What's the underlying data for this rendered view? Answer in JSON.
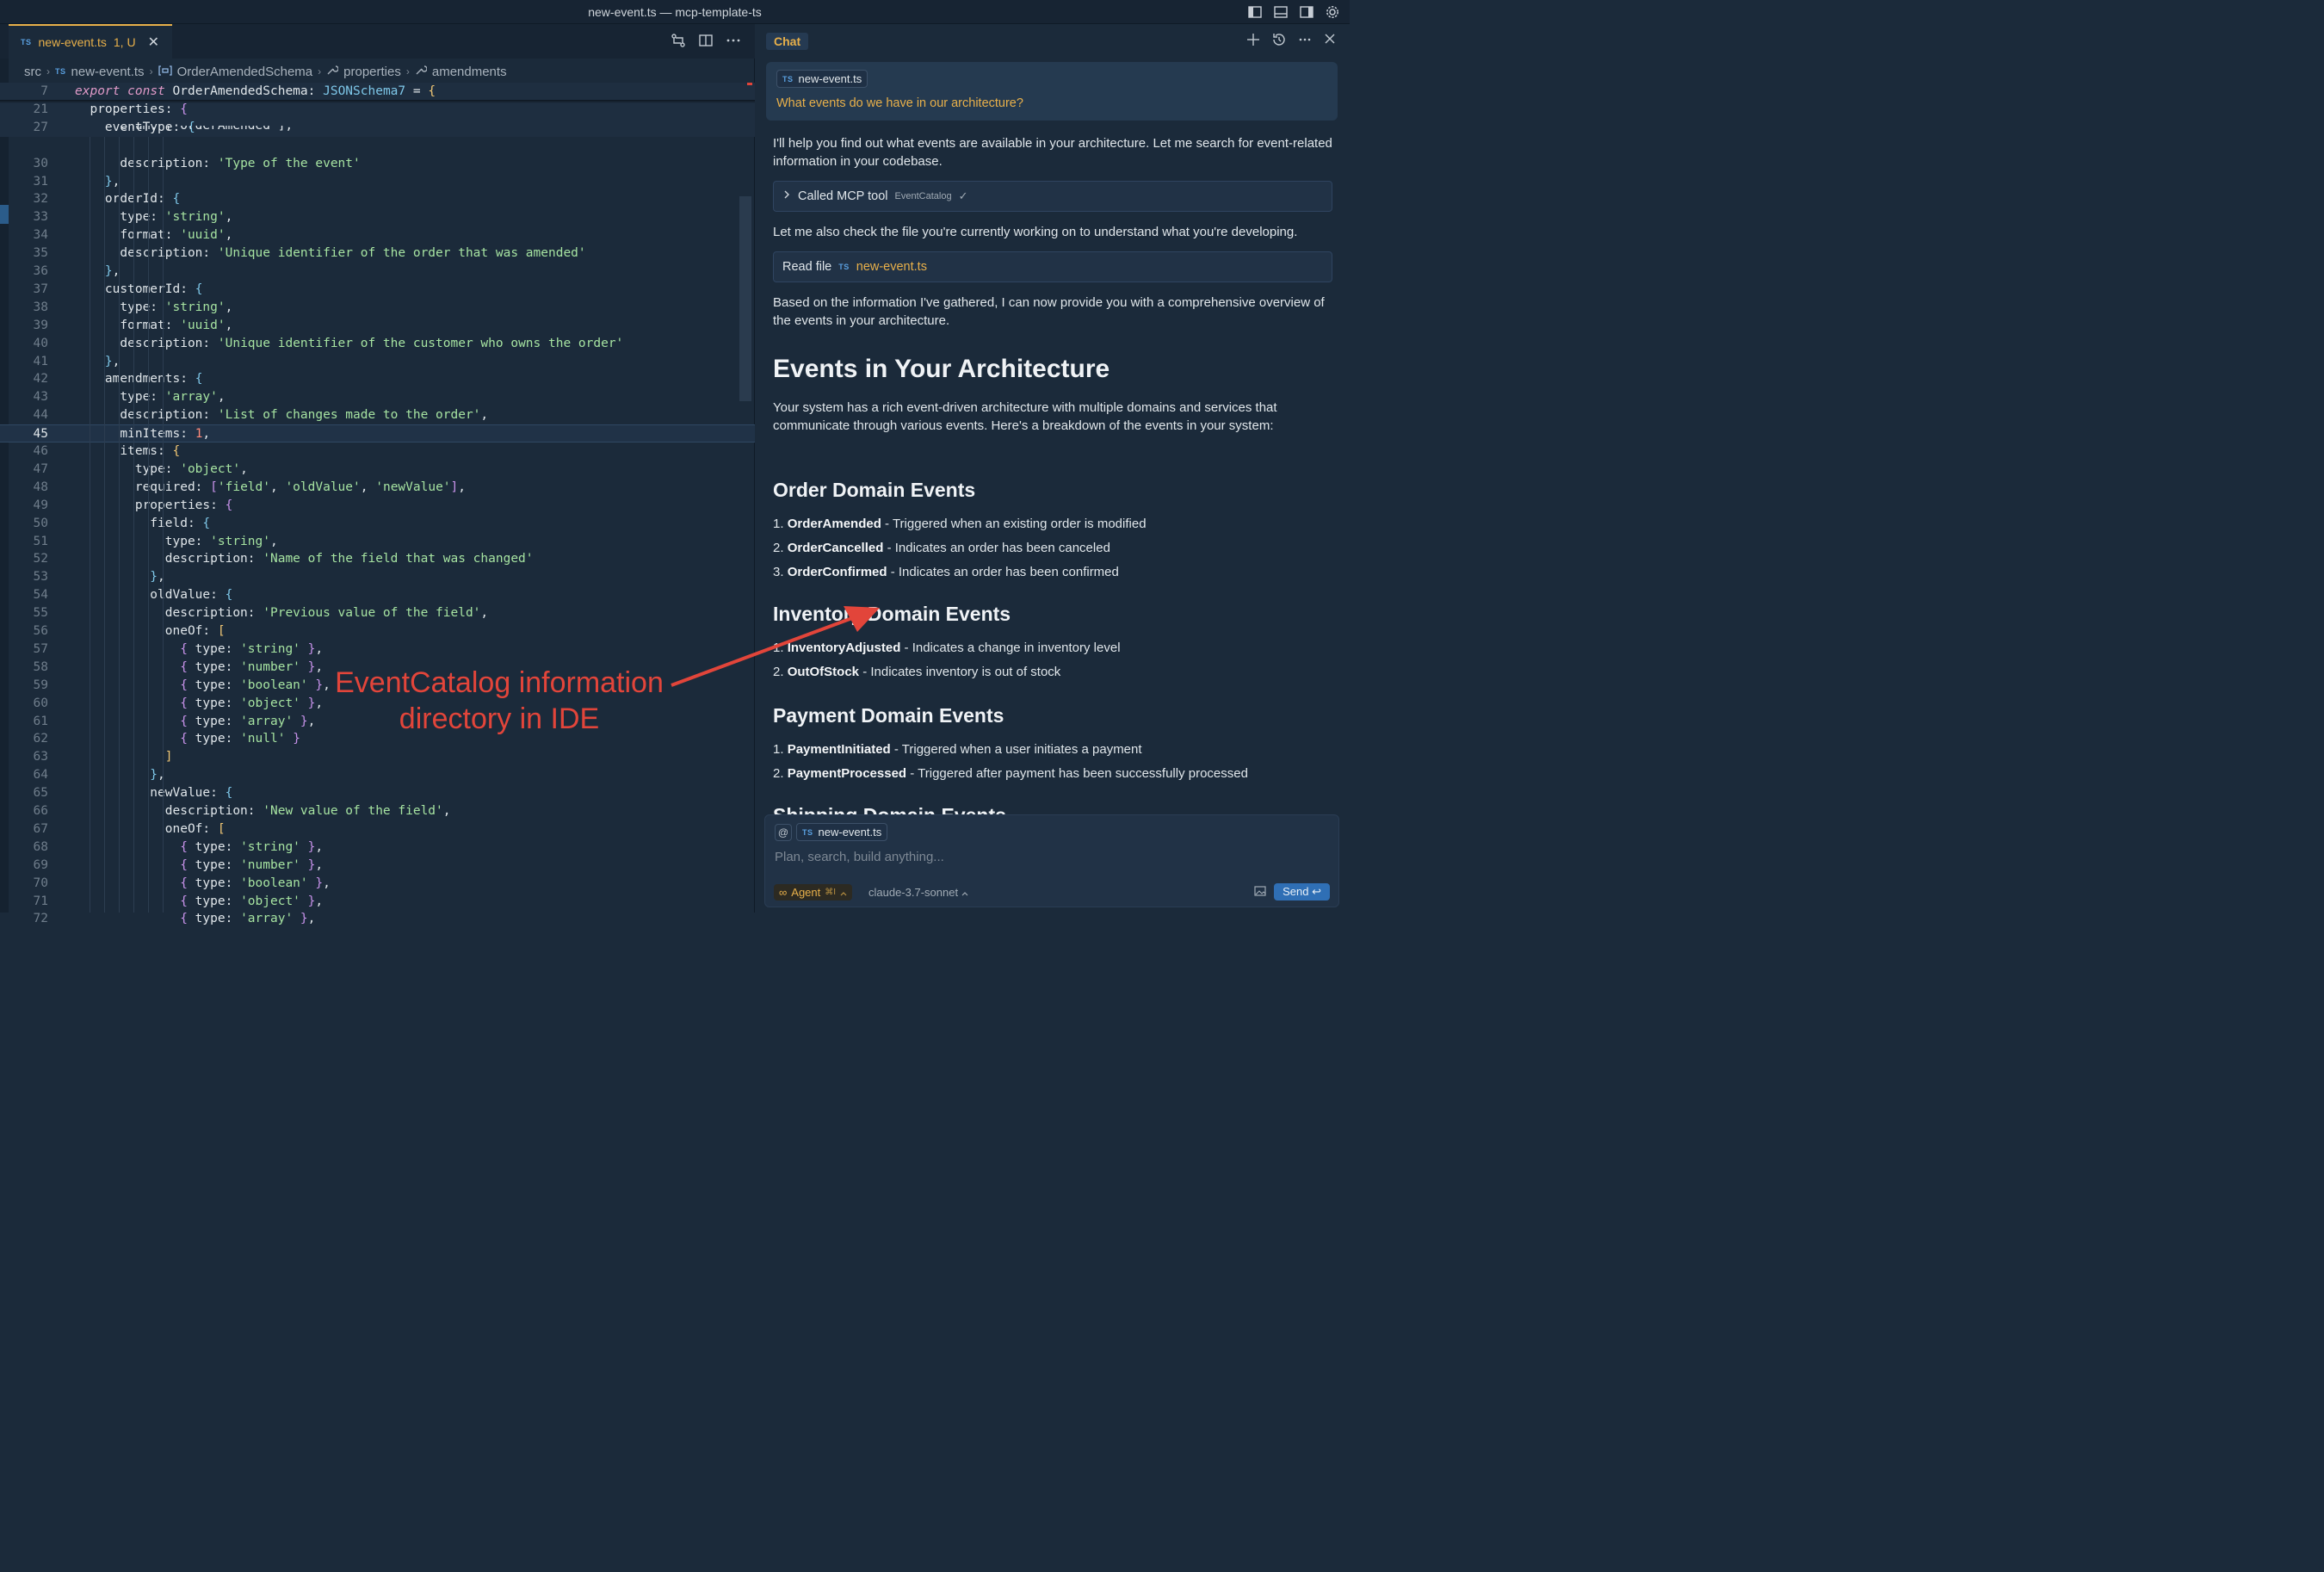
{
  "window": {
    "title": "new-event.ts — mcp-template-ts"
  },
  "editor": {
    "tab": {
      "badge": "TS",
      "label": "new-event.ts",
      "status": "1, U",
      "close": "✕"
    },
    "breadcrumb": [
      "src",
      "new-event.ts",
      "OrderAmendedSchema",
      "properties",
      "amendments"
    ],
    "breadcrumb_badge": "TS"
  },
  "annotation": {
    "line1": "EventCatalog information",
    "line2": "directory in IDE"
  },
  "chat": {
    "tab_label": "Chat",
    "user": {
      "chip": "new-event.ts",
      "chip_badge": "TS",
      "question": "What events do we have in our architecture?"
    },
    "intro": "I'll help you find out what events are available in your architecture. Let me search for event-related information in your codebase.",
    "tool_call": {
      "label": "Called MCP tool",
      "tool": "EventCatalog",
      "status": "✓"
    },
    "check_file_text": "Let me also check the file you're currently working on to understand what you're developing.",
    "read_file": {
      "label": "Read file",
      "badge": "TS",
      "file": "new-event.ts"
    },
    "summary": "Based on the information I've gathered, I can now provide you with a comprehensive overview of the events in your architecture.",
    "heading": "Events in Your Architecture",
    "overview": "Your system has a rich event-driven architecture with multiple domains and services that communicate through various events. Here's a breakdown of the events in your system:",
    "sections": [
      {
        "title": "Order Domain Events",
        "items": [
          {
            "num": "1.",
            "name": "OrderAmended",
            "desc": " - Triggered when an existing order is modified"
          },
          {
            "num": "2.",
            "name": "OrderCancelled",
            "desc": " - Indicates an order has been canceled"
          },
          {
            "num": "3.",
            "name": "OrderConfirmed",
            "desc": " - Indicates an order has been confirmed"
          }
        ]
      },
      {
        "title": "Inventory Domain Events",
        "items": [
          {
            "num": "1.",
            "name": "InventoryAdjusted",
            "desc": " - Indicates a change in inventory level"
          },
          {
            "num": "2.",
            "name": "OutOfStock",
            "desc": " - Indicates inventory is out of stock"
          }
        ]
      },
      {
        "title": "Payment Domain Events",
        "items": [
          {
            "num": "1.",
            "name": "PaymentInitiated",
            "desc": " - Triggered when a user initiates a payment"
          },
          {
            "num": "2.",
            "name": "PaymentProcessed",
            "desc": " - Triggered after payment has been successfully processed"
          }
        ]
      },
      {
        "title": "Shipping Domain Events",
        "items": []
      }
    ],
    "composer": {
      "at": "@",
      "chip": "new-event.ts",
      "chip_badge": "TS",
      "placeholder": "Plan, search, build anything...",
      "mode": "Agent",
      "mode_shortcut": "⌘I",
      "model": "claude-3.7-sonnet",
      "send": "Send"
    }
  },
  "code_lines": [
    {
      "n": "7"
    },
    {
      "n": "21"
    },
    {
      "n": "27"
    },
    {
      "n": "29"
    },
    {
      "n": "30"
    },
    {
      "n": "31"
    },
    {
      "n": "32"
    },
    {
      "n": "33"
    },
    {
      "n": "34"
    },
    {
      "n": "35"
    },
    {
      "n": "36"
    },
    {
      "n": "37"
    },
    {
      "n": "38"
    },
    {
      "n": "39"
    },
    {
      "n": "40"
    },
    {
      "n": "41"
    },
    {
      "n": "42"
    },
    {
      "n": "43"
    },
    {
      "n": "44"
    },
    {
      "n": "45"
    },
    {
      "n": "46"
    },
    {
      "n": "47"
    },
    {
      "n": "48"
    },
    {
      "n": "49"
    },
    {
      "n": "50"
    },
    {
      "n": "51"
    },
    {
      "n": "52"
    },
    {
      "n": "53"
    },
    {
      "n": "54"
    },
    {
      "n": "55"
    },
    {
      "n": "56"
    },
    {
      "n": "57"
    },
    {
      "n": "58"
    },
    {
      "n": "59"
    },
    {
      "n": "60"
    },
    {
      "n": "61"
    },
    {
      "n": "62"
    },
    {
      "n": "63"
    },
    {
      "n": "64"
    },
    {
      "n": "65"
    },
    {
      "n": "66"
    },
    {
      "n": "67"
    },
    {
      "n": "68"
    },
    {
      "n": "69"
    },
    {
      "n": "70"
    },
    {
      "n": "71"
    },
    {
      "n": "72"
    }
  ],
  "code_text": [
    [
      [
        "k",
        "export"
      ],
      [
        "id",
        " "
      ],
      [
        "k",
        "const"
      ],
      [
        "id",
        " OrderAmendedSchema: "
      ],
      [
        "ty",
        "JSONSchema7"
      ],
      [
        "id",
        " = "
      ],
      [
        "br1",
        "{"
      ]
    ],
    [
      [
        "id",
        "  properties: "
      ],
      [
        "br2",
        "{"
      ]
    ],
    [
      [
        "id",
        "    eventType: "
      ],
      [
        "br3",
        "{"
      ]
    ],
    [
      [
        "id",
        "      enum: ['OrderAmended'],"
      ]
    ],
    [
      [
        "id",
        "      description: "
      ],
      [
        "s",
        "'Type of the event'"
      ]
    ],
    [
      [
        "br3",
        "    }"
      ],
      [
        "id",
        ","
      ]
    ],
    [
      [
        "id",
        "    orderId: "
      ],
      [
        "br3",
        "{"
      ]
    ],
    [
      [
        "id",
        "      type: "
      ],
      [
        "s",
        "'string'"
      ],
      [
        "id",
        ","
      ]
    ],
    [
      [
        "id",
        "      format: "
      ],
      [
        "s",
        "'uuid'"
      ],
      [
        "id",
        ","
      ]
    ],
    [
      [
        "id",
        "      description: "
      ],
      [
        "s",
        "'Unique identifier of the order that was amended'"
      ]
    ],
    [
      [
        "br3",
        "    }"
      ],
      [
        "id",
        ","
      ]
    ],
    [
      [
        "id",
        "    customerId: "
      ],
      [
        "br3",
        "{"
      ]
    ],
    [
      [
        "id",
        "      type: "
      ],
      [
        "s",
        "'string'"
      ],
      [
        "id",
        ","
      ]
    ],
    [
      [
        "id",
        "      format: "
      ],
      [
        "s",
        "'uuid'"
      ],
      [
        "id",
        ","
      ]
    ],
    [
      [
        "id",
        "      description: "
      ],
      [
        "s",
        "'Unique identifier of the customer who owns the order'"
      ]
    ],
    [
      [
        "br3",
        "    }"
      ],
      [
        "id",
        ","
      ]
    ],
    [
      [
        "id",
        "    amendments: "
      ],
      [
        "br3",
        "{"
      ]
    ],
    [
      [
        "id",
        "      type: "
      ],
      [
        "s",
        "'array'"
      ],
      [
        "id",
        ","
      ]
    ],
    [
      [
        "id",
        "      description: "
      ],
      [
        "s",
        "'List of changes made to the order'"
      ],
      [
        "id",
        ","
      ]
    ],
    [
      [
        "id",
        "      minItems: "
      ],
      [
        "n",
        "1"
      ],
      [
        "id",
        ","
      ]
    ],
    [
      [
        "id",
        "      items: "
      ],
      [
        "br1",
        "{"
      ]
    ],
    [
      [
        "id",
        "        type: "
      ],
      [
        "s",
        "'object'"
      ],
      [
        "id",
        ","
      ]
    ],
    [
      [
        "id",
        "        required: "
      ],
      [
        "br2",
        "["
      ],
      [
        "s",
        "'field'"
      ],
      [
        "id",
        ", "
      ],
      [
        "s",
        "'oldValue'"
      ],
      [
        "id",
        ", "
      ],
      [
        "s",
        "'newValue'"
      ],
      [
        "br2",
        "]"
      ],
      [
        "id",
        ","
      ]
    ],
    [
      [
        "id",
        "        properties: "
      ],
      [
        "br2",
        "{"
      ]
    ],
    [
      [
        "id",
        "          field: "
      ],
      [
        "br3",
        "{"
      ]
    ],
    [
      [
        "id",
        "            type: "
      ],
      [
        "s",
        "'string'"
      ],
      [
        "id",
        ","
      ]
    ],
    [
      [
        "id",
        "            description: "
      ],
      [
        "s",
        "'Name of the field that was changed'"
      ]
    ],
    [
      [
        "br3",
        "          }"
      ],
      [
        "id",
        ","
      ]
    ],
    [
      [
        "id",
        "          oldValue: "
      ],
      [
        "br3",
        "{"
      ]
    ],
    [
      [
        "id",
        "            description: "
      ],
      [
        "s",
        "'Previous value of the field'"
      ],
      [
        "id",
        ","
      ]
    ],
    [
      [
        "id",
        "            oneOf: "
      ],
      [
        "br1",
        "["
      ]
    ],
    [
      [
        "id",
        "              "
      ],
      [
        "br2",
        "{"
      ],
      [
        "id",
        " type: "
      ],
      [
        "s",
        "'string'"
      ],
      [
        "id",
        " "
      ],
      [
        "br2",
        "}"
      ],
      [
        "id",
        ","
      ]
    ],
    [
      [
        "id",
        "              "
      ],
      [
        "br2",
        "{"
      ],
      [
        "id",
        " type: "
      ],
      [
        "s",
        "'number'"
      ],
      [
        "id",
        " "
      ],
      [
        "br2",
        "}"
      ],
      [
        "id",
        ","
      ]
    ],
    [
      [
        "id",
        "              "
      ],
      [
        "br2",
        "{"
      ],
      [
        "id",
        " type: "
      ],
      [
        "s",
        "'boolean'"
      ],
      [
        "id",
        " "
      ],
      [
        "br2",
        "}"
      ],
      [
        "id",
        ","
      ]
    ],
    [
      [
        "id",
        "              "
      ],
      [
        "br2",
        "{"
      ],
      [
        "id",
        " type: "
      ],
      [
        "s",
        "'object'"
      ],
      [
        "id",
        " "
      ],
      [
        "br2",
        "}"
      ],
      [
        "id",
        ","
      ]
    ],
    [
      [
        "id",
        "              "
      ],
      [
        "br2",
        "{"
      ],
      [
        "id",
        " type: "
      ],
      [
        "s",
        "'array'"
      ],
      [
        "id",
        " "
      ],
      [
        "br2",
        "}"
      ],
      [
        "id",
        ","
      ]
    ],
    [
      [
        "id",
        "              "
      ],
      [
        "br2",
        "{"
      ],
      [
        "id",
        " type: "
      ],
      [
        "s",
        "'null'"
      ],
      [
        "id",
        " "
      ],
      [
        "br2",
        "}"
      ]
    ],
    [
      [
        "br1",
        "            ]"
      ]
    ],
    [
      [
        "br3",
        "          }"
      ],
      [
        "id",
        ","
      ]
    ],
    [
      [
        "id",
        "          newValue: "
      ],
      [
        "br3",
        "{"
      ]
    ],
    [
      [
        "id",
        "            description: "
      ],
      [
        "s",
        "'New value of the field'"
      ],
      [
        "id",
        ","
      ]
    ],
    [
      [
        "id",
        "            oneOf: "
      ],
      [
        "br1",
        "["
      ]
    ],
    [
      [
        "id",
        "              "
      ],
      [
        "br2",
        "{"
      ],
      [
        "id",
        " type: "
      ],
      [
        "s",
        "'string'"
      ],
      [
        "id",
        " "
      ],
      [
        "br2",
        "}"
      ],
      [
        "id",
        ","
      ]
    ],
    [
      [
        "id",
        "              "
      ],
      [
        "br2",
        "{"
      ],
      [
        "id",
        " type: "
      ],
      [
        "s",
        "'number'"
      ],
      [
        "id",
        " "
      ],
      [
        "br2",
        "}"
      ],
      [
        "id",
        ","
      ]
    ],
    [
      [
        "id",
        "              "
      ],
      [
        "br2",
        "{"
      ],
      [
        "id",
        " type: "
      ],
      [
        "s",
        "'boolean'"
      ],
      [
        "id",
        " "
      ],
      [
        "br2",
        "}"
      ],
      [
        "id",
        ","
      ]
    ],
    [
      [
        "id",
        "              "
      ],
      [
        "br2",
        "{"
      ],
      [
        "id",
        " type: "
      ],
      [
        "s",
        "'object'"
      ],
      [
        "id",
        " "
      ],
      [
        "br2",
        "}"
      ],
      [
        "id",
        ","
      ]
    ],
    [
      [
        "id",
        "              "
      ],
      [
        "br2",
        "{"
      ],
      [
        "id",
        " type: "
      ],
      [
        "s",
        "'array'"
      ],
      [
        "id",
        " "
      ],
      [
        "br2",
        "}"
      ],
      [
        "id",
        ","
      ]
    ]
  ],
  "current_line": "45"
}
